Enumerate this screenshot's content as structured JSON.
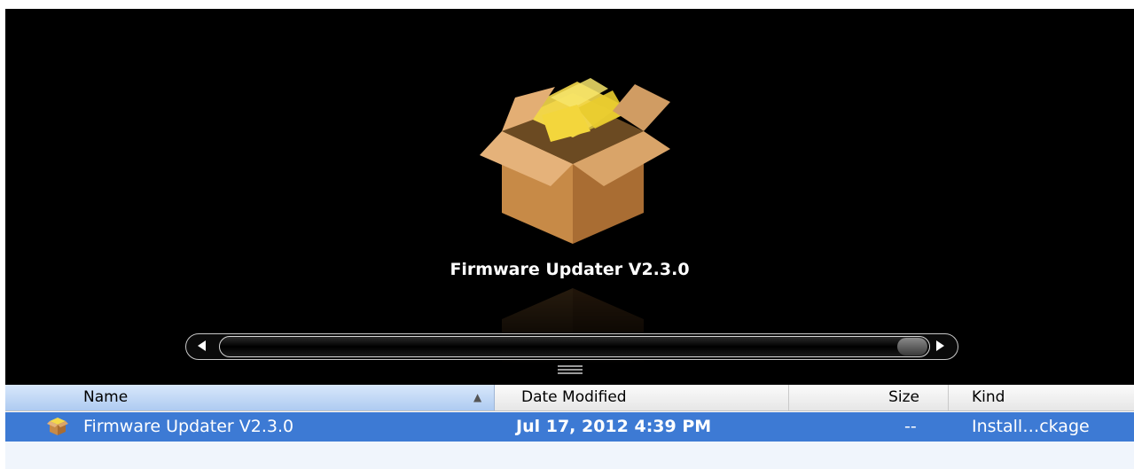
{
  "coverflow": {
    "item_title": "Firmware Updater V2.3.0",
    "icon": "installer-package-icon"
  },
  "scrollbar": {
    "left_arrow": "◀",
    "right_arrow": "▶"
  },
  "list": {
    "columns": {
      "name": "Name",
      "date_modified": "Date Modified",
      "size": "Size",
      "kind": "Kind",
      "sort_indicator": "▲"
    },
    "rows": [
      {
        "icon": "package-icon",
        "name": "Firmware Updater V2.3.0",
        "date_modified": "Jul 17, 2012 4:39 PM",
        "size": "--",
        "kind": "Install…ckage",
        "selected": true
      }
    ]
  },
  "colors": {
    "selection": "#3d7ad4",
    "coverflow_bg": "#000000",
    "sorted_header": "#aecbf1"
  }
}
